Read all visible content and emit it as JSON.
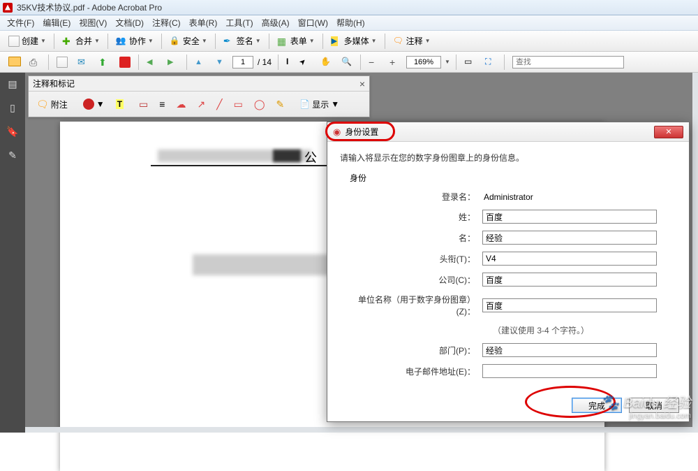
{
  "window": {
    "title": "35KV技术协议.pdf - Adobe Acrobat Pro"
  },
  "menu": {
    "file": "文件(F)",
    "edit": "编辑(E)",
    "view": "视图(V)",
    "document": "文档(D)",
    "comment": "注释(C)",
    "form": "表单(R)",
    "tools": "工具(T)",
    "advanced": "高级(A)",
    "window": "窗口(W)",
    "help": "帮助(H)"
  },
  "toolbar1": {
    "create": "创建",
    "combine": "合并",
    "collaborate": "协作",
    "secure": "安全",
    "sign": "签名",
    "forms": "表单",
    "multimedia": "多媒体",
    "comments": "注释"
  },
  "toolbar2": {
    "page_current": "1",
    "page_total": "/ 14",
    "zoom": "169%",
    "search_placeholder": "查找"
  },
  "anno_panel": {
    "title": "注释和标记",
    "note": "附注",
    "show": "显示"
  },
  "doc_text_fragment": "公",
  "dialog": {
    "title": "身份设置",
    "instruction": "请输入将显示在您的数字身份图章上的身份信息。",
    "group": "身份",
    "fields": {
      "login_label": "登录名：",
      "login_value": "Administrator",
      "surname_label": "姓：",
      "surname_value": "百度",
      "name_label": "名：",
      "name_value": "经验",
      "title_label": "头衔(T)：",
      "title_value": "V4",
      "company_label": "公司(C)：",
      "company_value": "百度",
      "orgname_label": "单位名称（用于数字身份图章）(Z)：",
      "orgname_value": "百度",
      "orgname_hint": "（建议使用 3-4 个字符。）",
      "dept_label": "部门(P)：",
      "dept_value": "经验",
      "email_label": "电子邮件地址(E)：",
      "email_value": ""
    },
    "complete_btn": "完成",
    "cancel_btn": "取消"
  },
  "watermark": {
    "brand": "Baidu 经验",
    "url": "jingyan.baidu.com"
  }
}
